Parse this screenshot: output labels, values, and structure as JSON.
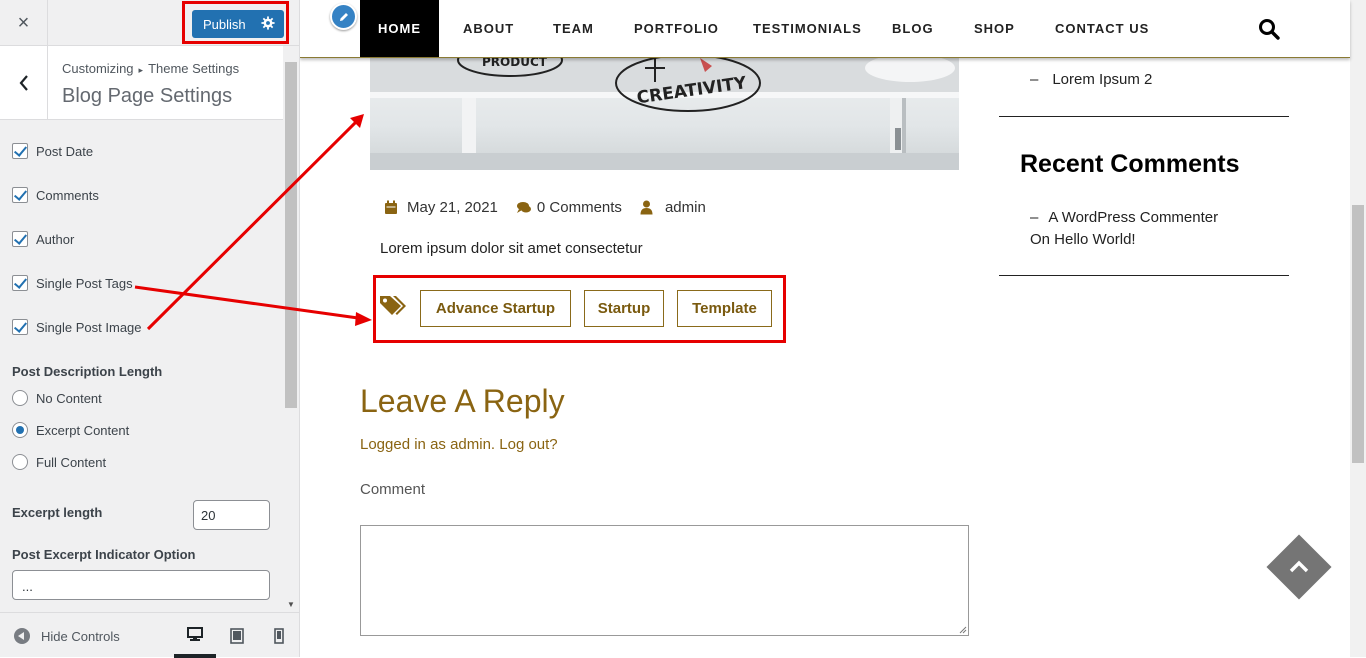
{
  "customizer": {
    "close_label": "×",
    "publish_label": "Publish",
    "breadcrumb": {
      "root": "Customizing",
      "separator": "▸",
      "parent": "Theme Settings"
    },
    "section_title": "Blog Page Settings",
    "checkboxes": [
      {
        "label": "Post Date",
        "checked": true
      },
      {
        "label": "Comments",
        "checked": true
      },
      {
        "label": "Author",
        "checked": true
      },
      {
        "label": "Single Post Tags",
        "checked": true
      },
      {
        "label": "Single Post Image",
        "checked": true
      }
    ],
    "description_length": {
      "label": "Post Description Length",
      "options": [
        {
          "label": "No Content",
          "selected": false
        },
        {
          "label": "Excerpt Content",
          "selected": true
        },
        {
          "label": "Full Content",
          "selected": false
        }
      ]
    },
    "excerpt_length": {
      "label": "Excerpt length",
      "value": "20"
    },
    "excerpt_indicator": {
      "label": "Post Excerpt Indicator Option",
      "value": "..."
    },
    "footer": {
      "hide_controls": "Hide Controls"
    }
  },
  "site": {
    "nav": [
      "HOME",
      "ABOUT",
      "TEAM",
      "PORTFOLIO",
      "TESTIMONIALS",
      "BLOG",
      "SHOP",
      "CONTACT US"
    ],
    "post": {
      "date": "May 21, 2021",
      "comments": "0 Comments",
      "author": "admin",
      "excerpt": "Lorem ipsum dolor sit amet consectetur",
      "tags": [
        "Advance Startup",
        "Startup",
        "Template"
      ],
      "hero_words": {
        "left": "PRODUCT",
        "right": "CREATIVITY"
      }
    },
    "reply": {
      "title": "Leave A Reply",
      "logged_in": "Logged in as admin. Log out?",
      "comment_label": "Comment"
    },
    "sidebar": {
      "top_list_item": "Lorem Ipsum 2",
      "top_list_bullet": "–",
      "recent_comments_title": "Recent Comments",
      "recent_comment_author": "A WordPress Commenter",
      "recent_comment_on": "On Hello World!"
    }
  },
  "colors": {
    "accent": "#8a6412",
    "wp_blue": "#2271b1",
    "highlight": "#e60000"
  }
}
